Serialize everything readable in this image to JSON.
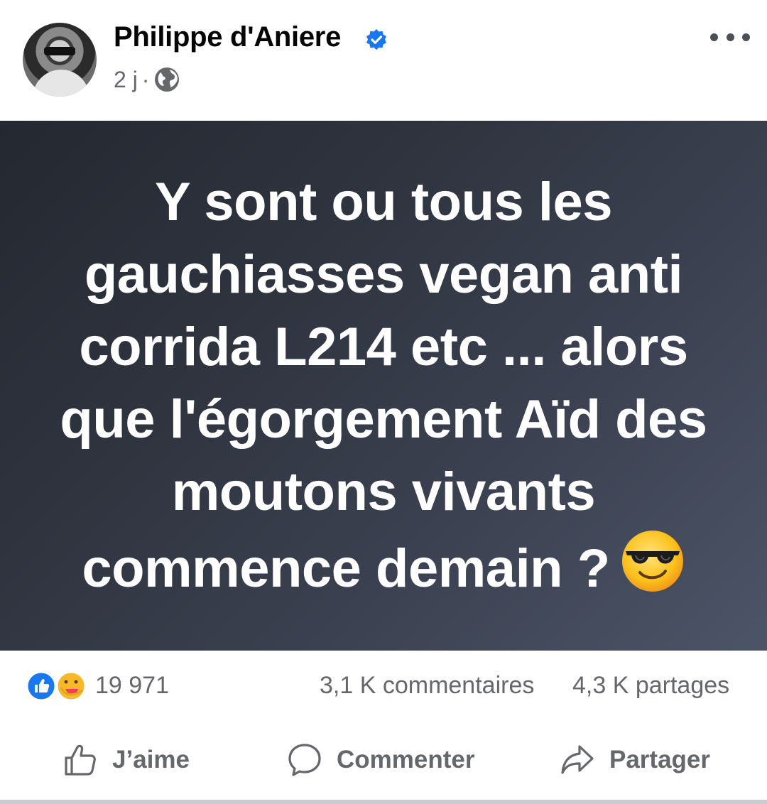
{
  "post": {
    "author": "Philippe d'Aniere",
    "time": "2 j",
    "separator": "·",
    "text": "Y sont ou tous les gauchiasses vegan anti corrida L214 etc ... alors que l'égorgement Aïd des moutons vivants commence demain ?"
  },
  "stats": {
    "reactions": "19 971",
    "comments": "3,1 K commentaires",
    "shares": "4,3 K partages"
  },
  "actions": {
    "like": "J’aime",
    "comment": "Commenter",
    "share": "Partager"
  },
  "colors": {
    "accent": "#1877f2",
    "muted_text": "#65676b",
    "card_dark": "#242830",
    "card_light": "#4c5467",
    "care_yellow": "#f7b928",
    "care_heart": "#f33e58"
  },
  "icons": [
    "verified-badge-icon",
    "globe-icon",
    "more-options-icon",
    "like-reaction-icon",
    "care-reaction-icon",
    "sunglasses-emoji",
    "thumbs-up-icon",
    "comment-bubble-icon",
    "share-arrow-icon"
  ]
}
